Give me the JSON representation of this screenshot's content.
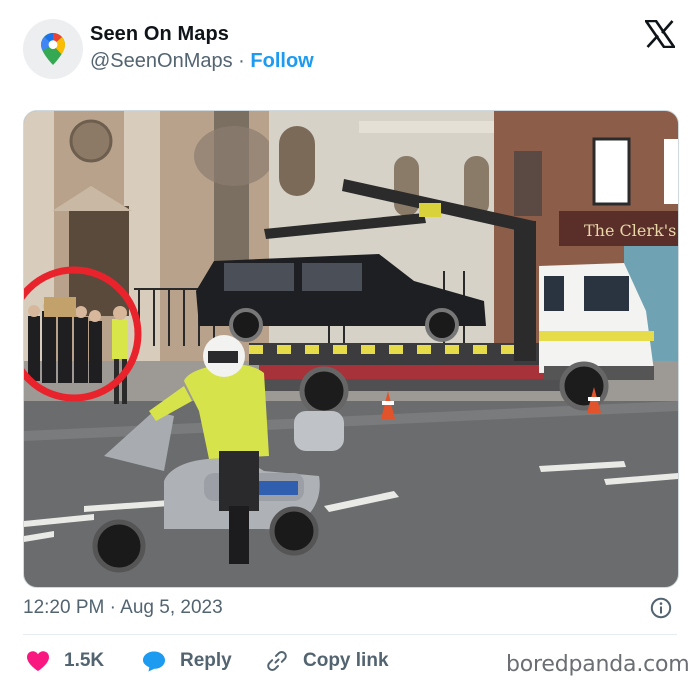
{
  "account": {
    "name": "Seen On Maps",
    "handle": "@SeenOnMaps",
    "separator": "·",
    "follow_label": "Follow"
  },
  "media": {
    "storefront_sign": "The Clerk's"
  },
  "meta": {
    "timestamp": "12:20 PM · Aug 5, 2023"
  },
  "actions": {
    "likes": "1.5K",
    "reply_label": "Reply",
    "copy_label": "Copy link"
  },
  "watermark": "boredpanda.com",
  "colors": {
    "like": "#f91880",
    "reply": "#1d9bf0",
    "follow": "#1d9bf0",
    "highlight_circle": "#e8232b"
  },
  "icons": [
    "google-maps-pin-icon",
    "x-logo-icon",
    "info-icon",
    "heart-icon",
    "reply-bubble-icon",
    "link-icon"
  ]
}
